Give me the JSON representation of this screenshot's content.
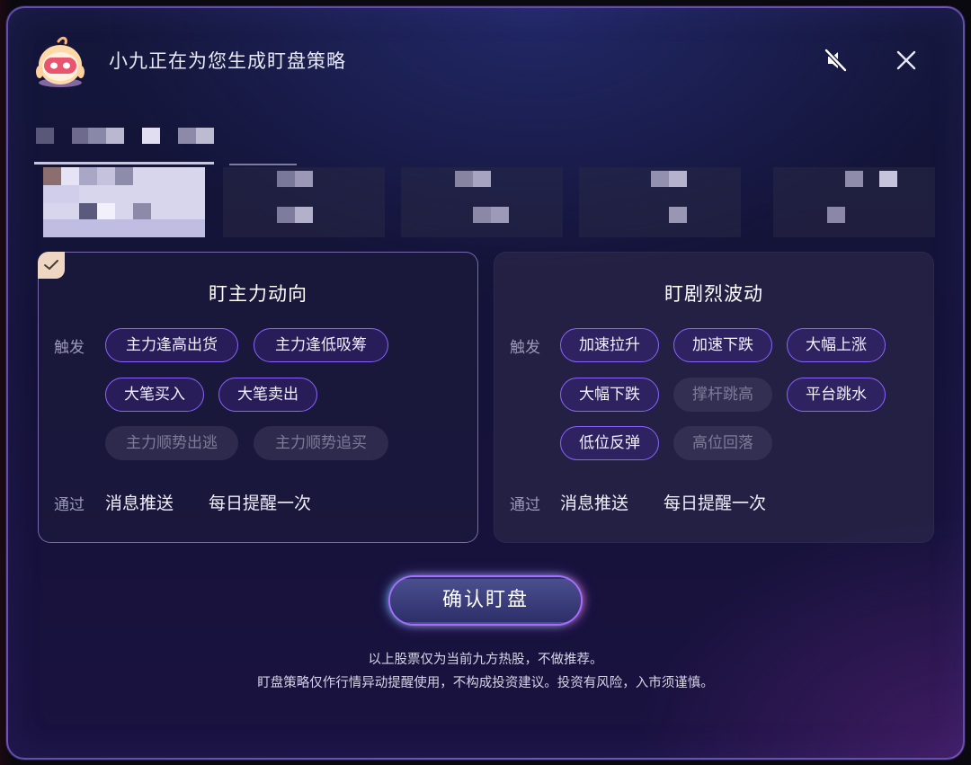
{
  "dialog": {
    "title": "小九正在为您生成盯盘策略",
    "mute_icon": "speaker-muted-icon",
    "close_icon": "close-icon"
  },
  "strategies": [
    {
      "title": "盯主力动向",
      "selected": true,
      "trigger_label": "触发",
      "triggers": [
        {
          "label": "主力逢高出货",
          "active": true
        },
        {
          "label": "主力逢低吸筹",
          "active": true
        },
        {
          "label": "大笔买入",
          "active": true
        },
        {
          "label": "大笔卖出",
          "active": true
        },
        {
          "label": "主力顺势出逃",
          "active": false
        },
        {
          "label": "主力顺势追买",
          "active": false
        }
      ],
      "via_label": "通过",
      "via_method": "消息推送",
      "frequency": "每日提醒一次"
    },
    {
      "title": "盯剧烈波动",
      "selected": false,
      "trigger_label": "触发",
      "triggers": [
        {
          "label": "加速拉升",
          "active": true
        },
        {
          "label": "加速下跌",
          "active": true
        },
        {
          "label": "大幅上涨",
          "active": true
        },
        {
          "label": "大幅下跌",
          "active": true
        },
        {
          "label": "撑杆跳高",
          "active": false
        },
        {
          "label": "平台跳水",
          "active": true
        },
        {
          "label": "低位反弹",
          "active": true
        },
        {
          "label": "高位回落",
          "active": false
        }
      ],
      "via_label": "通过",
      "via_method": "消息推送",
      "frequency": "每日提醒一次"
    }
  ],
  "confirm_label": "确认盯盘",
  "disclaimer": {
    "line1": "以上股票仅为当前九方热股，不做推荐。",
    "line2": "盯盘策略仅作行情异动提醒使用，不构成投资建议。投资有风险，入市须谨慎。"
  },
  "colors": {
    "accent": "#8a62ff",
    "badge": "#efd6c3",
    "panel_border": "#aa96e6"
  }
}
